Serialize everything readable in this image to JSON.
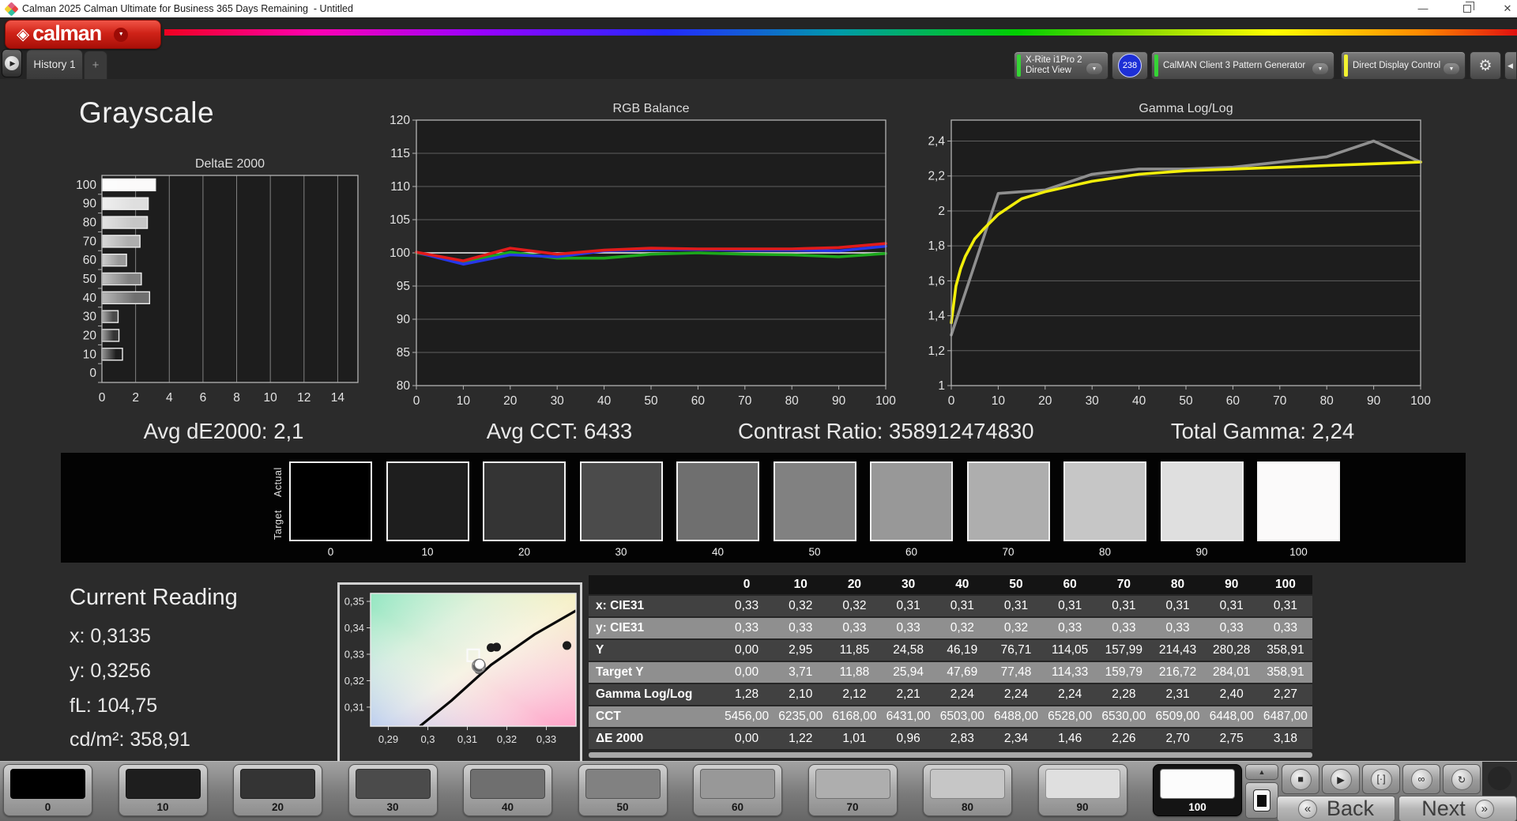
{
  "titlebar": {
    "title": "Calman 2025 Calman Ultimate for Business 365 Days Remaining  - Untitled"
  },
  "header": {
    "logo_text": "calman",
    "tab_label": "History 1",
    "add_tab_label": "+",
    "meter_dropdown": {
      "line1": "X-Rite i1Pro 2",
      "line2": "Direct View",
      "badge": "238"
    },
    "pattern_dropdown": "CalMAN Client 3 Pattern Generator",
    "display_dropdown": "Direct Display Control"
  },
  "page_title": "Grayscale",
  "stats": {
    "avg_de": "Avg dE2000: 2,1",
    "avg_cct": "Avg CCT: 6433",
    "contrast": "Contrast Ratio: 358912474830",
    "total_gamma": "Total Gamma: 2,24"
  },
  "chart_data": [
    {
      "id": "deltae",
      "type": "bar",
      "title": "DeltaE 2000",
      "orientation": "horizontal",
      "categories": [
        "0",
        "10",
        "20",
        "30",
        "40",
        "50",
        "60",
        "70",
        "80",
        "90",
        "100"
      ],
      "values": [
        0.0,
        1.22,
        1.01,
        0.96,
        2.83,
        2.34,
        1.46,
        2.26,
        2.7,
        2.75,
        3.18
      ],
      "xlim": [
        0,
        15.2
      ],
      "xticks": [
        0,
        2,
        4,
        6,
        8,
        10,
        12,
        14
      ],
      "bar_colors": [
        "#000000",
        "#1e1e1e",
        "#343434",
        "#4b4b4b",
        "#6f6f6f",
        "#818181",
        "#989898",
        "#aeaeae",
        "#c6c6c6",
        "#dfdfdf",
        "#fbfafa"
      ]
    },
    {
      "id": "rgb-balance",
      "type": "line",
      "title": "RGB Balance",
      "x": [
        0,
        10,
        20,
        30,
        40,
        50,
        60,
        70,
        80,
        90,
        100
      ],
      "ylim": [
        80,
        120
      ],
      "yticks": [
        80,
        85,
        90,
        95,
        100,
        105,
        110,
        115,
        120
      ],
      "ytick_labels": [
        "80",
        "85",
        "90",
        "95",
        "100",
        "105",
        "110",
        "115",
        "120"
      ],
      "xticks": [
        0,
        10,
        20,
        30,
        40,
        50,
        60,
        70,
        80,
        90,
        100
      ],
      "reference_y": 100,
      "series": [
        {
          "name": "Green",
          "color": "#1ca81c",
          "values": [
            100.0,
            98.6,
            100.1,
            99.2,
            99.2,
            99.8,
            100.0,
            99.8,
            99.7,
            99.4,
            99.9
          ]
        },
        {
          "name": "Blue",
          "color": "#2737e8",
          "values": [
            100.1,
            98.3,
            99.7,
            99.4,
            100.3,
            100.5,
            100.5,
            100.4,
            100.4,
            100.3,
            101.0
          ]
        },
        {
          "name": "Red",
          "color": "#e11b1b",
          "values": [
            100.1,
            98.8,
            100.7,
            99.8,
            100.4,
            100.7,
            100.6,
            100.6,
            100.6,
            100.8,
            101.4
          ]
        }
      ]
    },
    {
      "id": "gamma",
      "type": "line",
      "title": "Gamma Log/Log",
      "ylim": [
        1.0,
        2.52
      ],
      "yticks": [
        1,
        1.2,
        1.4,
        1.6,
        1.8,
        2,
        2.2,
        2.4
      ],
      "ytick_labels": [
        "1",
        "1,2",
        "1,4",
        "1,6",
        "1,8",
        "2",
        "2,2",
        "2,4"
      ],
      "xticks": [
        0,
        10,
        20,
        30,
        40,
        50,
        60,
        70,
        80,
        90,
        100
      ],
      "series": [
        {
          "name": "Measured",
          "color": "#8f8f8f",
          "x": [
            0,
            10,
            20,
            30,
            40,
            50,
            60,
            70,
            80,
            90,
            100
          ],
          "values": [
            1.29,
            2.1,
            2.12,
            2.21,
            2.24,
            2.24,
            2.25,
            2.28,
            2.31,
            2.4,
            2.28
          ]
        },
        {
          "name": "Target",
          "color": "#f2ee0a",
          "x": [
            0,
            1,
            2,
            3,
            5,
            7,
            10,
            15,
            20,
            30,
            40,
            50,
            60,
            70,
            80,
            90,
            100
          ],
          "values": [
            1.36,
            1.57,
            1.67,
            1.74,
            1.84,
            1.9,
            1.98,
            2.07,
            2.11,
            2.17,
            2.21,
            2.23,
            2.24,
            2.25,
            2.26,
            2.27,
            2.28
          ]
        }
      ]
    },
    {
      "id": "cie",
      "type": "scatter",
      "xlim": [
        0.2855,
        0.3375
      ],
      "ylim": [
        0.3028,
        0.353
      ],
      "xticks": [
        0.29,
        0.3,
        0.31,
        0.32,
        0.33
      ],
      "xtick_labels": [
        "0,29",
        "0,3",
        "0,31",
        "0,32",
        "0,33"
      ],
      "yticks": [
        0.31,
        0.32,
        0.33,
        0.34,
        0.35
      ],
      "ytick_labels": [
        "0,31",
        "0,32",
        "0,33",
        "0,34",
        "0,35"
      ],
      "locus": [
        [
          0.298,
          0.3028
        ],
        [
          0.306,
          0.3125
        ],
        [
          0.316,
          0.326
        ],
        [
          0.327,
          0.3375
        ],
        [
          0.3375,
          0.3465
        ]
      ],
      "points": [
        {
          "x": 0.316,
          "y": 0.3325,
          "type": "dot-dark"
        },
        {
          "x": 0.3174,
          "y": 0.3327,
          "type": "dot-dark"
        },
        {
          "x": 0.3352,
          "y": 0.3333,
          "type": "dot-dark"
        },
        {
          "x": 0.3128,
          "y": 0.324,
          "type": "dot-gray"
        },
        {
          "x": 0.3124,
          "y": 0.3252,
          "type": "dot-gray"
        },
        {
          "x": 0.3115,
          "y": 0.3296,
          "type": "square-target"
        },
        {
          "x": 0.3131,
          "y": 0.3262,
          "type": "circle-current"
        }
      ]
    }
  ],
  "swatch_strip": {
    "actual_label": "Actual",
    "target_label": "Target",
    "levels": [
      "0",
      "10",
      "20",
      "30",
      "40",
      "50",
      "60",
      "70",
      "80",
      "90",
      "100"
    ],
    "colors": [
      "#000000",
      "#1e1e1e",
      "#343434",
      "#4b4b4b",
      "#6f6f6f",
      "#818181",
      "#989898",
      "#aeaeae",
      "#c6c6c6",
      "#dfdfdf",
      "#fbfafa"
    ]
  },
  "current_reading": {
    "title": "Current Reading",
    "x": "x: 0,3135",
    "y": "y: 0,3256",
    "fl": "fL: 104,75",
    "cd": "cd/m²: 358,91"
  },
  "table": {
    "columns": [
      "0",
      "10",
      "20",
      "30",
      "40",
      "50",
      "60",
      "70",
      "80",
      "90",
      "100"
    ],
    "rows": [
      {
        "label": "x: CIE31",
        "values": [
          "0,33",
          "0,32",
          "0,32",
          "0,31",
          "0,31",
          "0,31",
          "0,31",
          "0,31",
          "0,31",
          "0,31",
          "0,31"
        ]
      },
      {
        "label": "y: CIE31",
        "values": [
          "0,33",
          "0,33",
          "0,33",
          "0,33",
          "0,32",
          "0,32",
          "0,33",
          "0,33",
          "0,33",
          "0,33",
          "0,33"
        ]
      },
      {
        "label": "Y",
        "values": [
          "0,00",
          "2,95",
          "11,85",
          "24,58",
          "46,19",
          "76,71",
          "114,05",
          "157,99",
          "214,43",
          "280,28",
          "358,91"
        ]
      },
      {
        "label": "Target Y",
        "values": [
          "0,00",
          "3,71",
          "11,88",
          "25,94",
          "47,69",
          "77,48",
          "114,33",
          "159,79",
          "216,72",
          "284,01",
          "358,91"
        ]
      },
      {
        "label": "Gamma Log/Log",
        "values": [
          "1,28",
          "2,10",
          "2,12",
          "2,21",
          "2,24",
          "2,24",
          "2,24",
          "2,28",
          "2,31",
          "2,40",
          "2,27"
        ]
      },
      {
        "label": "CCT",
        "values": [
          "5456,00",
          "6235,00",
          "6168,00",
          "6431,00",
          "6503,00",
          "6488,00",
          "6528,00",
          "6530,00",
          "6509,00",
          "6448,00",
          "6487,00"
        ]
      },
      {
        "label": "ΔE 2000",
        "values": [
          "0,00",
          "1,22",
          "1,01",
          "0,96",
          "2,83",
          "2,34",
          "1,46",
          "2,26",
          "2,70",
          "2,75",
          "3,18"
        ]
      }
    ]
  },
  "bottom": {
    "tiles": [
      "0",
      "10",
      "20",
      "30",
      "40",
      "50",
      "60",
      "70",
      "80",
      "90",
      "100"
    ],
    "tile_colors": [
      "#000000",
      "#1e1e1e",
      "#343434",
      "#4b4b4b",
      "#6f6f6f",
      "#818181",
      "#989898",
      "#aeaeae",
      "#c6c6c6",
      "#dfdfdf",
      "#fcfcfc"
    ],
    "selected_level": "100",
    "controls": [
      {
        "name": "stop",
        "glyph": "■"
      },
      {
        "name": "play",
        "glyph": "▶"
      },
      {
        "name": "single-measure",
        "glyph": "[·]"
      },
      {
        "name": "continuous",
        "glyph": "∞"
      },
      {
        "name": "loop",
        "glyph": "↻"
      }
    ],
    "back_label": "Back",
    "next_label": "Next",
    "back_glyph": "«",
    "next_glyph": "»"
  }
}
